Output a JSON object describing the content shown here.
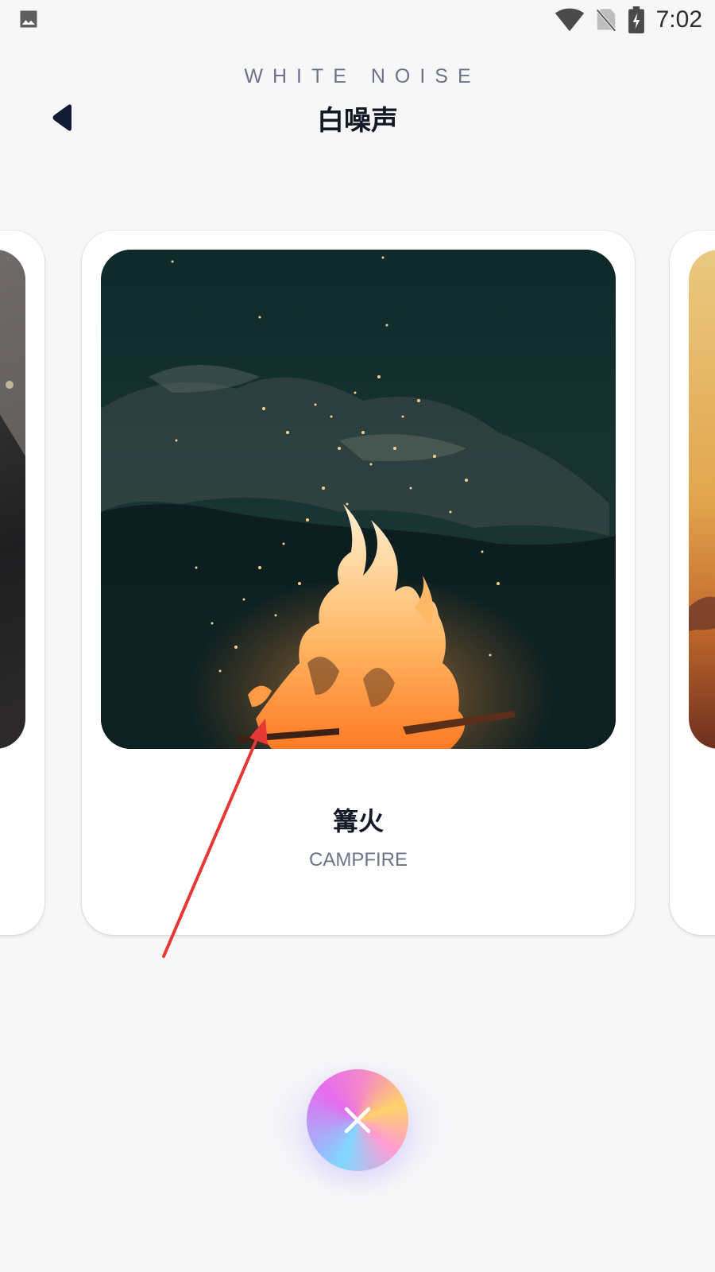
{
  "status_bar": {
    "time": "7:02",
    "icons": [
      "image-icon",
      "wifi-icon",
      "no-sim-icon",
      "battery-charging-icon"
    ]
  },
  "header": {
    "subtitle": "WHITE NOISE",
    "title": "白噪声",
    "back_icon": "back-triangle-icon"
  },
  "carousel": {
    "cards": [
      {
        "title": "",
        "subtitle": "",
        "image": "dark rainy window scene"
      },
      {
        "title": "篝火",
        "subtitle": "CAMPFIRE",
        "image": "campfire with sparks at night"
      },
      {
        "title": "",
        "subtitle": "",
        "image": "sunset scene"
      }
    ],
    "active_index": 1
  },
  "close_button": {
    "icon": "close-icon"
  },
  "colors": {
    "background": "#f7f7f8",
    "title": "#121826",
    "subtitle": "#6b7489",
    "annotation_arrow": "#e53935"
  }
}
